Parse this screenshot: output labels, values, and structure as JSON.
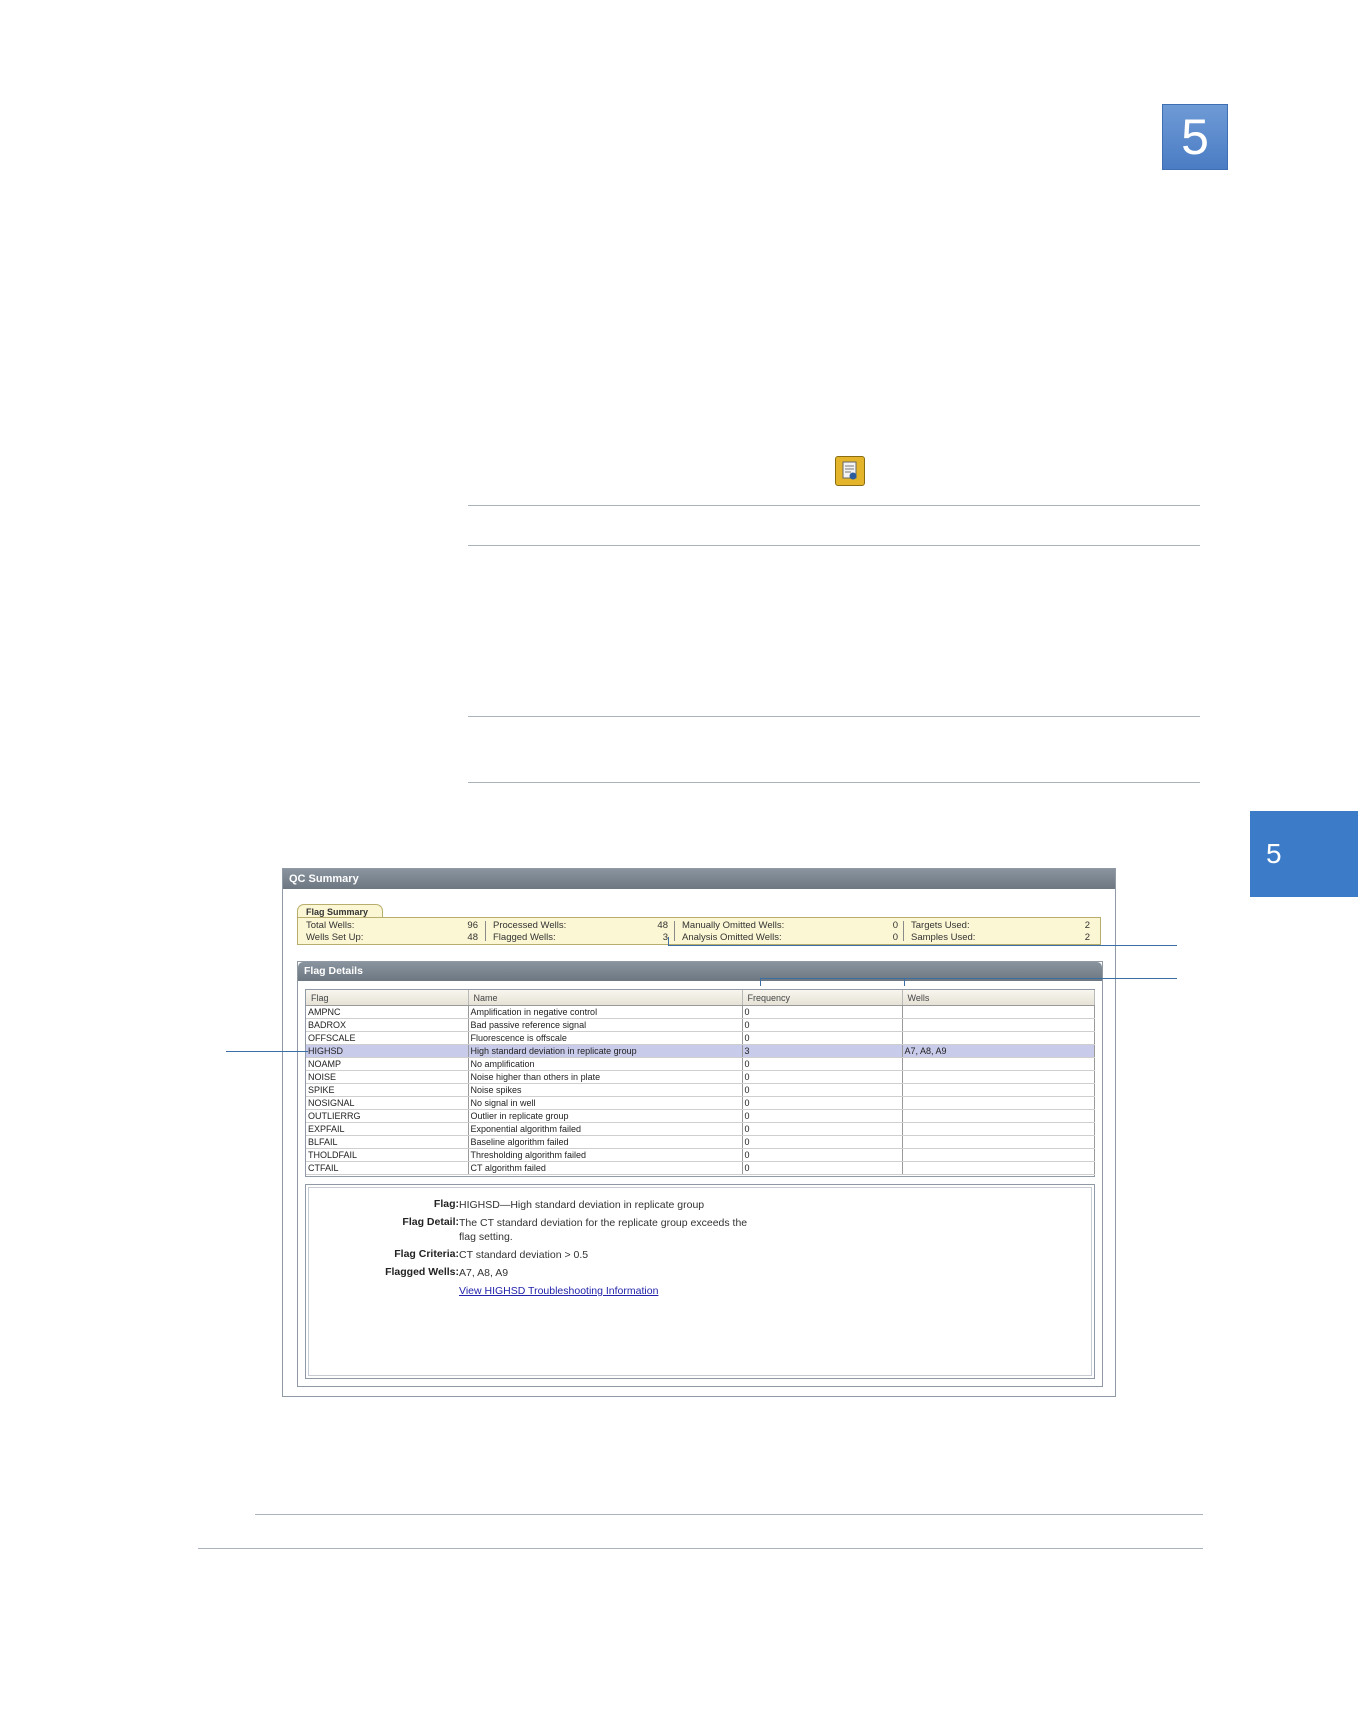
{
  "chapter": {
    "number_top": "5",
    "number_side": "5"
  },
  "icons": {
    "report_icon": "document-report-icon"
  },
  "qc_summary": {
    "title": "QC Summary",
    "flag_summary_tab": "Flag Summary",
    "stats": {
      "total_wells_label": "Total Wells:",
      "total_wells_value": "96",
      "wells_set_up_label": "Wells Set Up:",
      "wells_set_up_value": "48",
      "processed_wells_label": "Processed Wells:",
      "processed_wells_value": "48",
      "flagged_wells_label": "Flagged Wells:",
      "flagged_wells_value": "3",
      "manually_omitted_label": "Manually Omitted Wells:",
      "manually_omitted_value": "0",
      "analysis_omitted_label": "Analysis Omitted Wells:",
      "analysis_omitted_value": "0",
      "targets_used_label": "Targets Used:",
      "targets_used_value": "2",
      "samples_used_label": "Samples Used:",
      "samples_used_value": "2"
    },
    "flag_details": {
      "title": "Flag Details",
      "columns": [
        "Flag",
        "Name",
        "Frequency",
        "Wells"
      ],
      "rows": [
        {
          "flag": "AMPNC",
          "name": "Amplification in negative control",
          "frequency": "0",
          "wells": ""
        },
        {
          "flag": "BADROX",
          "name": "Bad passive reference signal",
          "frequency": "0",
          "wells": ""
        },
        {
          "flag": "OFFSCALE",
          "name": "Fluorescence is offscale",
          "frequency": "0",
          "wells": ""
        },
        {
          "flag": "HIGHSD",
          "name": "High standard deviation in replicate group",
          "frequency": "3",
          "wells": "A7, A8, A9"
        },
        {
          "flag": "NOAMP",
          "name": "No amplification",
          "frequency": "0",
          "wells": ""
        },
        {
          "flag": "NOISE",
          "name": "Noise higher than others in plate",
          "frequency": "0",
          "wells": ""
        },
        {
          "flag": "SPIKE",
          "name": "Noise spikes",
          "frequency": "0",
          "wells": ""
        },
        {
          "flag": "NOSIGNAL",
          "name": "No signal in well",
          "frequency": "0",
          "wells": ""
        },
        {
          "flag": "OUTLIERRG",
          "name": "Outlier in replicate group",
          "frequency": "0",
          "wells": ""
        },
        {
          "flag": "EXPFAIL",
          "name": "Exponential algorithm failed",
          "frequency": "0",
          "wells": ""
        },
        {
          "flag": "BLFAIL",
          "name": "Baseline algorithm failed",
          "frequency": "0",
          "wells": ""
        },
        {
          "flag": "THOLDFAIL",
          "name": "Thresholding algorithm failed",
          "frequency": "0",
          "wells": ""
        },
        {
          "flag": "CTFAIL",
          "name": "CT algorithm failed",
          "frequency": "0",
          "wells": ""
        }
      ]
    },
    "detail": {
      "flag_label": "Flag:",
      "flag_value": "HIGHSD—High standard deviation in replicate group",
      "flag_detail_label": "Flag Detail:",
      "flag_detail_value_1": "The CT standard deviation for the replicate group exceeds the",
      "flag_detail_value_2": "flag setting.",
      "flag_criteria_label": "Flag Criteria:",
      "flag_criteria_value": "CT standard deviation > 0.5",
      "flagged_wells_label": "Flagged Wells:",
      "flagged_wells_value": "A7, A8, A9",
      "troubleshooting_link": "View HIGHSD Troubleshooting Information"
    }
  }
}
